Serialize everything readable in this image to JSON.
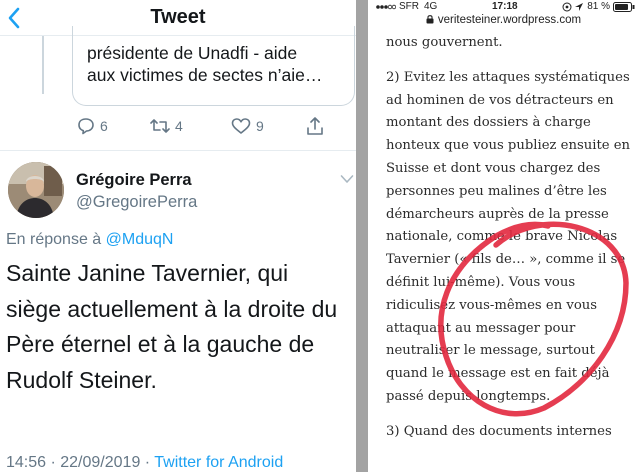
{
  "twitter": {
    "header": {
      "title": "Tweet"
    },
    "quoted": {
      "lines": [
        "présidente de Unadfi - aide",
        "aux victimes de sectes n’aie…"
      ]
    },
    "actions": {
      "reply_count": "6",
      "retweet_count": "4",
      "like_count": "9"
    },
    "author": {
      "name": "Grégoire Perra",
      "handle": "@GregoirePerra"
    },
    "reply_to": {
      "prefix": "En réponse à ",
      "mention": "@MduqN"
    },
    "body_lines": [
      "Sainte Janine Tavernier, qui",
      "siège actuellement à la droite du",
      "Père éternel et à la gauche de",
      "Rudolf Steiner."
    ],
    "meta": {
      "datetime": "14:56 · 22/09/2019 · ",
      "client": "Twitter for Android"
    }
  },
  "browser": {
    "status": {
      "carrier": "SFR",
      "network": "4G",
      "time": "17:18",
      "battery": "81 %"
    },
    "url": "veritesteiner.wordpress.com",
    "article": {
      "p1": [
        "nous gouvernent."
      ],
      "p2": [
        "2) Evitez les attaques systématiques",
        "ad hominen de vos détracteurs en",
        "montant des dossiers à charge",
        "honteux que vous publiez ensuite en",
        "Suisse et dont vous chargez des",
        "personnes peu malines d’être les",
        "démarcheurs auprès de la presse",
        "nationale, comme le brave Nicolas",
        "Tavernier (« fils de… », comme il se",
        "définit lui-même). Vous vous",
        "ridiculisez vous-mêmes en vous",
        "attaquant au messager pour",
        "neutraliser le message, surtout",
        "quand le message est en fait déjà",
        "passé depuis longtemps."
      ],
      "p3": [
        "3) Quand des documents internes"
      ]
    },
    "annotation": {
      "color": "#e2283e"
    }
  },
  "colors": {
    "twitter_blue": "#1da1f2",
    "gray_text": "#657786",
    "divider": "#a3a3a3"
  }
}
